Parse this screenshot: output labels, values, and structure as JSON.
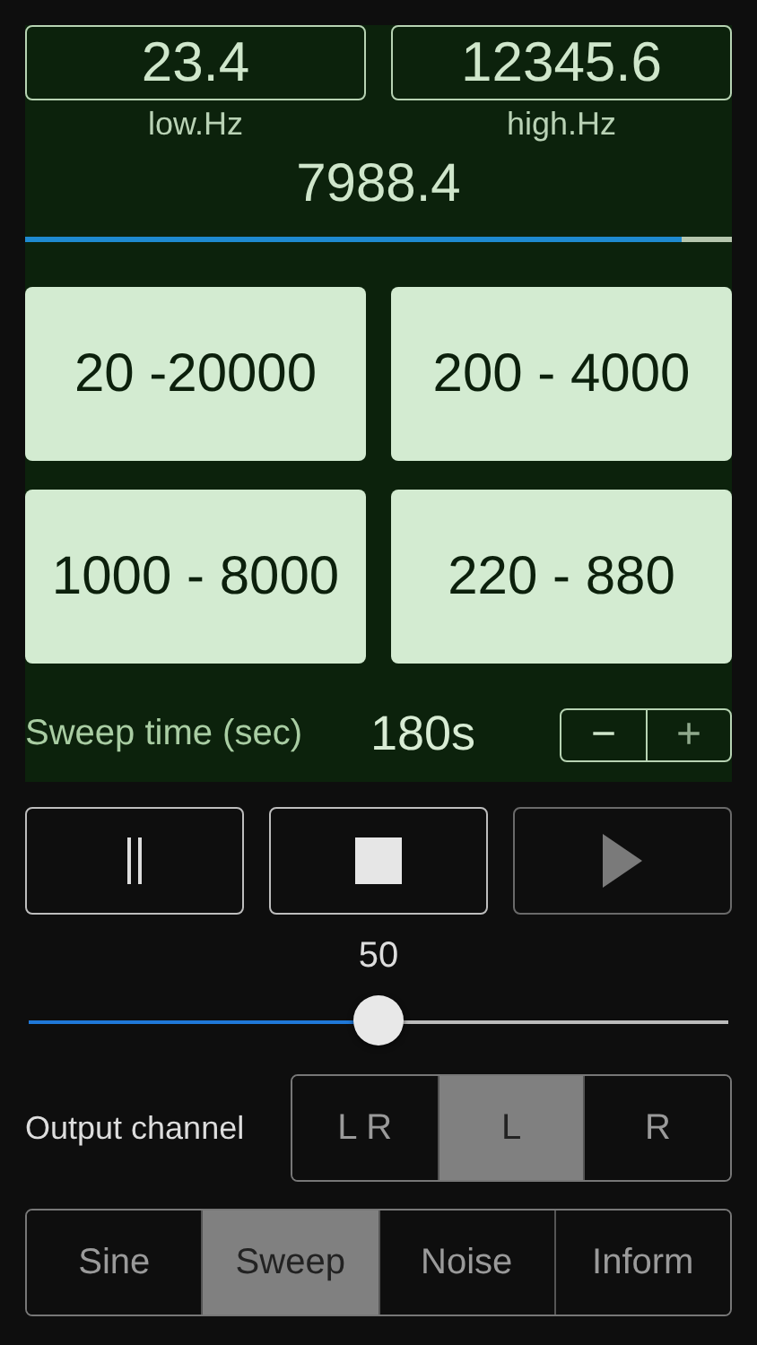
{
  "range": [
    {
      "value": "23.4",
      "label": "low.Hz"
    },
    {
      "value": "12345.6",
      "label": "high.Hz"
    }
  ],
  "current_frequency": "7988.4",
  "sweep_progress": {
    "level": 0.93
  },
  "presets": [
    "20 -20000",
    "200 - 4000",
    "1000 - 8000",
    "220 - 880"
  ],
  "sweep_time": {
    "label": "Sweep time (sec)",
    "value": "180s",
    "decrement": "−",
    "increment": "+"
  },
  "transport": [
    {
      "kind": "pause",
      "disabled": false
    },
    {
      "kind": "stop",
      "disabled": false
    },
    {
      "kind": "play",
      "disabled": true
    }
  ],
  "volume": {
    "value": "50",
    "level": 0.5
  },
  "output_channel": {
    "label": "Output channel",
    "options": [
      {
        "label": "L R",
        "selected": false
      },
      {
        "label": "L",
        "selected": true
      },
      {
        "label": "R",
        "selected": false
      }
    ]
  },
  "modes": [
    {
      "label": "Sine",
      "selected": false
    },
    {
      "label": "Sweep",
      "selected": true
    },
    {
      "label": "Noise",
      "selected": false
    },
    {
      "label": "Inform",
      "selected": false
    }
  ]
}
